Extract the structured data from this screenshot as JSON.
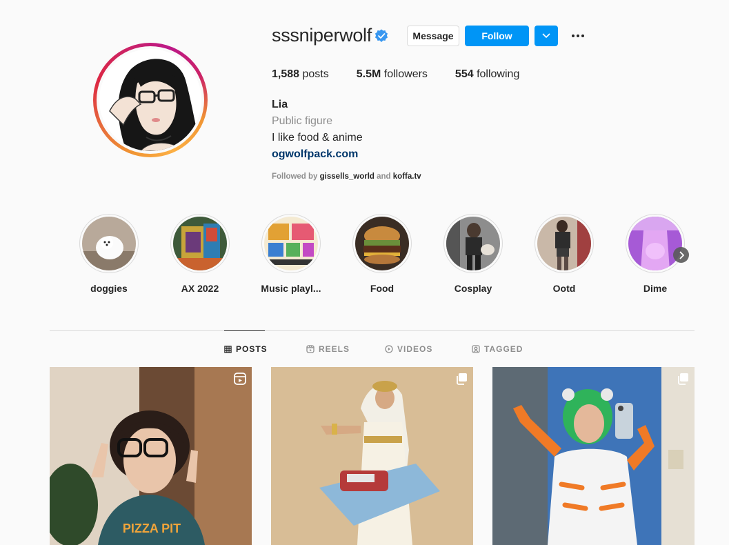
{
  "profile": {
    "username": "sssniperwolf",
    "verified": true,
    "buttons": {
      "message": "Message",
      "follow": "Follow"
    },
    "stats": [
      {
        "value": "1,588",
        "label": "posts"
      },
      {
        "value": "5.5M",
        "label": "followers"
      },
      {
        "value": "554",
        "label": "following"
      }
    ],
    "bio": {
      "name": "Lia",
      "category": "Public figure",
      "text": "I like food & anime",
      "link": "ogwolfpack.com"
    },
    "followed_by": {
      "prefix": "Followed by",
      "user1": "gissells_world",
      "joiner": "and",
      "user2": "koffa.tv"
    }
  },
  "highlights": [
    {
      "label": "doggies"
    },
    {
      "label": "AX 2022"
    },
    {
      "label": "Music playl..."
    },
    {
      "label": "Food"
    },
    {
      "label": "Cosplay"
    },
    {
      "label": "Ootd"
    },
    {
      "label": "Dime"
    }
  ],
  "tabs": [
    {
      "label": "POSTS",
      "icon": "grid-icon",
      "active": true
    },
    {
      "label": "REELS",
      "icon": "reels-icon"
    },
    {
      "label": "VIDEOS",
      "icon": "video-play-icon"
    },
    {
      "label": "TAGGED",
      "icon": "tag-icon"
    }
  ],
  "posts": [
    {
      "type": "reel",
      "shirt_text": "PIZZA PIT"
    },
    {
      "type": "carousel"
    },
    {
      "type": "carousel"
    }
  ],
  "colors": {
    "accent": "#0095f6",
    "link": "#00376b",
    "muted": "#8e8e8e",
    "text": "#262626"
  }
}
